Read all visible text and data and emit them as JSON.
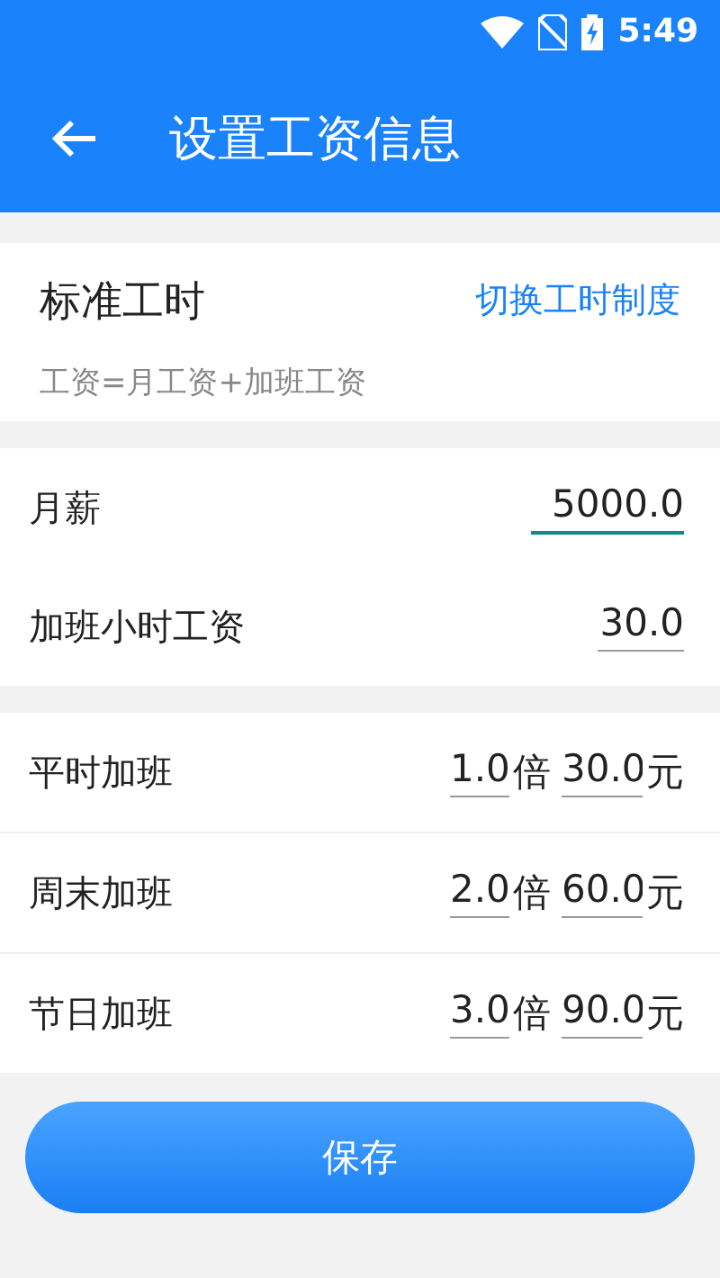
{
  "status_bar": {
    "time": "5:49"
  },
  "header": {
    "title": "设置工资信息"
  },
  "work_hours": {
    "title": "标准工时",
    "switch_link": "切换工时制度",
    "formula": "工资=月工资+加班工资"
  },
  "salary_fields": [
    {
      "label": "月薪",
      "value": "5000.0",
      "focused": true
    },
    {
      "label": "加班小时工资",
      "value": "30.0",
      "focused": false
    }
  ],
  "overtime_rows": [
    {
      "label": "平时加班",
      "multiplier": "1.0",
      "multiplier_unit": "倍",
      "amount": "30.0",
      "amount_unit": "元"
    },
    {
      "label": "周末加班",
      "multiplier": "2.0",
      "multiplier_unit": "倍",
      "amount": "60.0",
      "amount_unit": "元"
    },
    {
      "label": "节日加班",
      "multiplier": "3.0",
      "multiplier_unit": "倍",
      "amount": "90.0",
      "amount_unit": "元"
    }
  ],
  "save_button": "保存"
}
